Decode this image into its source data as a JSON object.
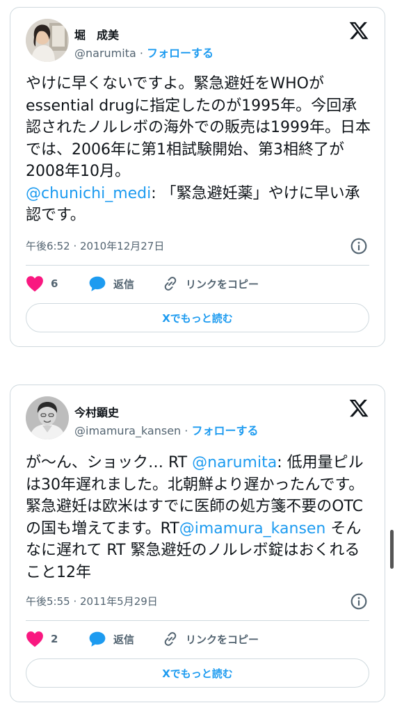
{
  "tweets": [
    {
      "author_name": "堀　成美",
      "handle": "@narumita",
      "separator": " · ",
      "follow_label": "フォローする",
      "text_1": "やけに早くないですよ。緊急避妊をWHOがessential drugに指定したのが1995年。今回承認されたノルレボの海外での販売は1999年。日本では、2006年に第1相試験開始、第3相終了が2008年10月。\n",
      "mention_1": "@chunichi_medi",
      "text_2": ": 「緊急避妊薬」やけに早い承認です。",
      "timestamp": "午後6:52 · 2010年12月27日",
      "like_count": "6",
      "reply_label": "返信",
      "copy_link_label": "リンクをコピー",
      "read_more_label": "Xでもっと読む",
      "avatar_icon": "avatar-photo-woman"
    },
    {
      "author_name": "今村顕史",
      "handle": "@imamura_kansen",
      "separator": " · ",
      "follow_label": "フォローする",
      "text_1": "が〜ん、ショック… RT ",
      "mention_1": "@narumita",
      "text_2": ": 低用量ピルは30年遅れました。北朝鮮より遅かったんです。緊急避妊は欧米はすでに医師の処方箋不要のOTCの国も増えてます。RT",
      "mention_2": "@imamura_kansen",
      "text_3": " そんなに遅れて RT 緊急避妊のノルレボ錠はおくれること12年",
      "timestamp": "午後5:55 · 2011年5月29日",
      "like_count": "2",
      "reply_label": "返信",
      "copy_link_label": "リンクをコピー",
      "read_more_label": "Xでもっと読む",
      "avatar_icon": "avatar-photo-man"
    }
  ],
  "colors": {
    "accent": "#1d9bf0",
    "like": "#f91880",
    "text": "#0f1419",
    "secondary": "#536471",
    "border": "#cfd9de"
  },
  "icons": [
    "x-logo-icon",
    "info-icon",
    "heart-icon",
    "reply-bubble-icon",
    "link-icon"
  ]
}
